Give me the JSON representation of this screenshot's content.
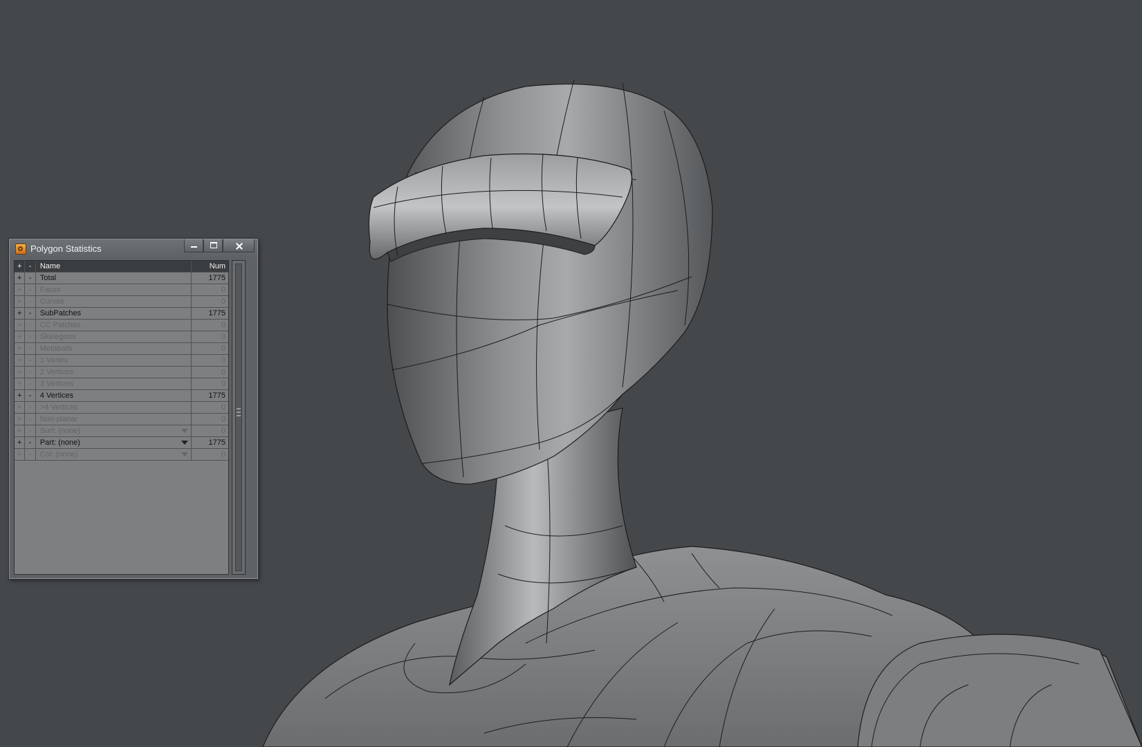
{
  "window": {
    "title": "Polygon Statistics"
  },
  "table": {
    "headers": {
      "plus": "+",
      "minus": "-",
      "name": "Name",
      "num": "Num"
    },
    "rows": [
      {
        "name": "Total",
        "num": "1775",
        "active": true
      },
      {
        "name": "Faces",
        "num": "0",
        "active": false
      },
      {
        "name": "Curves",
        "num": "0",
        "active": false
      },
      {
        "name": "SubPatches",
        "num": "1775",
        "active": true
      },
      {
        "name": "CC Patches",
        "num": "0",
        "active": false
      },
      {
        "name": "Skelegons",
        "num": "0",
        "active": false
      },
      {
        "name": "Metaballs",
        "num": "0",
        "active": false
      },
      {
        "name": "1 Vertex",
        "num": "0",
        "active": false
      },
      {
        "name": "2 Vertices",
        "num": "0",
        "active": false
      },
      {
        "name": "3 Vertices",
        "num": "0",
        "active": false
      },
      {
        "name": "4 Vertices",
        "num": "1775",
        "active": true
      },
      {
        "name": ">4 Vertices",
        "num": "0",
        "active": false
      },
      {
        "name": "Non-planar",
        "num": "0",
        "active": false
      },
      {
        "name": "Surf: (none)",
        "num": "0",
        "active": false,
        "dropdown": true
      },
      {
        "name": "Part: (none)",
        "num": "1775",
        "active": true,
        "dropdown": true
      },
      {
        "name": "Col: (none)",
        "num": "0",
        "active": false,
        "dropdown": true
      }
    ]
  },
  "icons": {
    "app": "lightwave-app-icon",
    "minimize": "minimize-icon",
    "maximize": "maximize-icon",
    "close": "close-icon"
  },
  "colors": {
    "viewport_bg": "#45484b",
    "header_bg": "#3a3d40",
    "table_bg": "#7d7f81"
  }
}
